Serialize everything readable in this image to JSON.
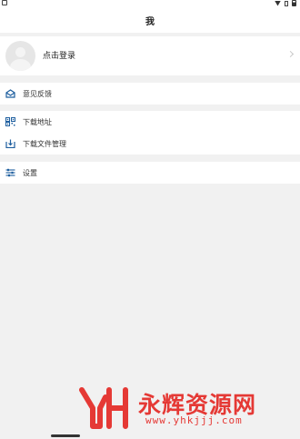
{
  "header": {
    "title": "我"
  },
  "login": {
    "label": "点击登录"
  },
  "menu": {
    "section1": [
      {
        "label": "意见反馈",
        "icon": "feedback-icon"
      }
    ],
    "section2": [
      {
        "label": "下载地址",
        "icon": "qr-code-icon"
      },
      {
        "label": "下载文件管理",
        "icon": "download-icon"
      }
    ],
    "section3": [
      {
        "label": "设置",
        "icon": "settings-icon"
      }
    ]
  },
  "watermark": {
    "text": "永辉资源网",
    "url": "www.yhkjjj.com",
    "color": "#e53935"
  },
  "colors": {
    "accent": "#1f5f9f",
    "background": "#f1f1f1",
    "card": "#ffffff"
  }
}
